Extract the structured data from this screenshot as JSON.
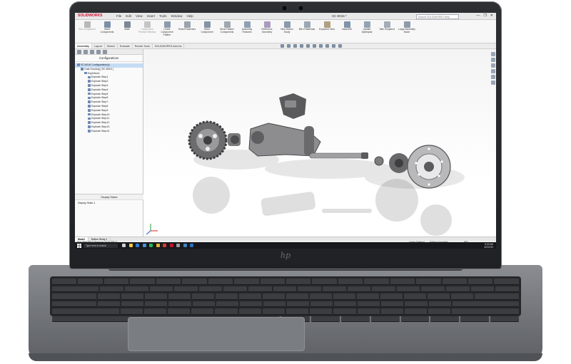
{
  "app": {
    "brand": "SOLIDWORKS",
    "menu": [
      "File",
      "Edit",
      "View",
      "Insert",
      "Tools",
      "Window",
      "Help"
    ],
    "document_title": "SC-8016 *",
    "search_placeholder": "Search SOLIDWORKS Help",
    "window_buttons": [
      "—",
      "❐",
      "✕"
    ]
  },
  "ribbon": {
    "buttons": [
      {
        "label": "Edit Component",
        "icon": "edit-component-icon",
        "color": "#b8b8b8",
        "dim": true
      },
      {
        "label": "Insert Components",
        "icon": "insert-components-icon",
        "color": "#7b8fa8",
        "dim": false
      },
      {
        "label": "Mate",
        "icon": "mate-icon",
        "color": "#7d8794",
        "dim": false
      },
      {
        "label": "Component Preview Window",
        "icon": "preview-window-icon",
        "color": "#c5c5c5",
        "dim": true
      },
      {
        "label": "Linear Component Pattern",
        "icon": "linear-pattern-icon",
        "color": "#8c9aad",
        "dim": false
      },
      {
        "label": "Smart Fasteners",
        "icon": "smart-fasteners-icon",
        "color": "#9ba4ae",
        "dim": false
      },
      {
        "label": "Move Component",
        "icon": "move-component-icon",
        "color": "#8593a6",
        "dim": false
      },
      {
        "label": "Show Hidden Components",
        "icon": "show-hidden-icon",
        "color": "#a0a8b2",
        "dim": false
      },
      {
        "label": "Assembly Features",
        "icon": "assembly-features-icon",
        "color": "#8ea0b5",
        "dim": false
      },
      {
        "label": "Reference Geometry",
        "icon": "reference-geometry-icon",
        "color": "#a99bc0",
        "dim": false
      },
      {
        "label": "New Motion Study",
        "icon": "motion-study-icon",
        "color": "#8a99ab",
        "dim": false
      },
      {
        "label": "Bill of Materials",
        "icon": "bom-icon",
        "color": "#9aa7b4",
        "dim": false
      },
      {
        "label": "Exploded View",
        "icon": "exploded-view-icon",
        "color": "#b0a07f",
        "dim": false
      },
      {
        "label": "Instant3D",
        "icon": "instant3d-icon",
        "color": "#7f93ab",
        "dim": false
      },
      {
        "label": "Update Speedpak",
        "icon": "speedpak-icon",
        "color": "#94a3b3",
        "dim": false
      },
      {
        "label": "Take Snapshot",
        "icon": "snapshot-icon",
        "color": "#a2adb8",
        "dim": false
      },
      {
        "label": "Large Assembly Mode",
        "icon": "large-assembly-icon",
        "color": "#8d9aa9",
        "dim": false
      }
    ]
  },
  "tabs": [
    "Assembly",
    "Layout",
    "Sketch",
    "Evaluate",
    "Render Tools",
    "SOLIDWORKS Add-Ins"
  ],
  "active_tab": "Assembly",
  "panel": {
    "header": "Configurations",
    "tree": [
      {
        "label": "SC-8016 Configuration(s)",
        "indent": 0,
        "selected": true
      },
      {
        "label": "Cast Housing [ SC-8016 ]",
        "indent": 1,
        "selected": false
      },
      {
        "label": "ExplView1",
        "indent": 2,
        "selected": false
      },
      {
        "label": "Explode Step1",
        "indent": 3,
        "selected": false
      },
      {
        "label": "Explode Step2",
        "indent": 3,
        "selected": false
      },
      {
        "label": "Explode Step3",
        "indent": 3,
        "selected": false
      },
      {
        "label": "Explode Step4",
        "indent": 3,
        "selected": false
      },
      {
        "label": "Explode Step5",
        "indent": 3,
        "selected": false
      },
      {
        "label": "Explode Step6",
        "indent": 3,
        "selected": false
      },
      {
        "label": "Explode Step7",
        "indent": 3,
        "selected": false
      },
      {
        "label": "Explode Step8",
        "indent": 3,
        "selected": false
      },
      {
        "label": "Explode Step9",
        "indent": 3,
        "selected": false
      },
      {
        "label": "Explode Step10",
        "indent": 3,
        "selected": false
      },
      {
        "label": "Explode Step11",
        "indent": 3,
        "selected": false
      },
      {
        "label": "Explode Step12",
        "indent": 3,
        "selected": false
      },
      {
        "label": "Explode Step13",
        "indent": 3,
        "selected": false
      },
      {
        "label": "Explode Step14",
        "indent": 3,
        "selected": false
      }
    ],
    "display_states_header": "Display States",
    "display_states": [
      "Display State-1"
    ]
  },
  "model_tabs": [
    "Model",
    "Motion Study 1"
  ],
  "status": {
    "left": "SOLIDWORKS Premium 2019 SP0.0",
    "under_defined": "Under Defined",
    "editing": "Editing Assembly",
    "units": "IPS"
  },
  "taskbar": {
    "search_placeholder": "Type here to search",
    "apps": [
      {
        "icon": "task-view-icon",
        "color": "#cfcfcf"
      },
      {
        "icon": "file-explorer-icon",
        "color": "#f2c744"
      },
      {
        "icon": "edge-icon",
        "color": "#2b7cd3"
      },
      {
        "icon": "store-icon",
        "color": "#4a8fd8"
      },
      {
        "icon": "spotify-icon",
        "color": "#1db954"
      },
      {
        "icon": "chrome-icon",
        "color": "#e0b43a"
      },
      {
        "icon": "acrobat-icon",
        "color": "#d43b2c"
      },
      {
        "icon": "solidworks-icon",
        "color": "#c8102e"
      },
      {
        "icon": "settings-icon",
        "color": "#9a9a9a"
      },
      {
        "icon": "photos-icon",
        "color": "#3c82c4"
      },
      {
        "icon": "mail-icon",
        "color": "#2a6fc1"
      }
    ],
    "time": "8:00 AM",
    "date": "6/2/2019"
  },
  "colors": {
    "solidworks_red": "#c8102e",
    "selection": "#c5dcf5",
    "bezel": "#1f2124",
    "chassis": "#7a7d82"
  }
}
